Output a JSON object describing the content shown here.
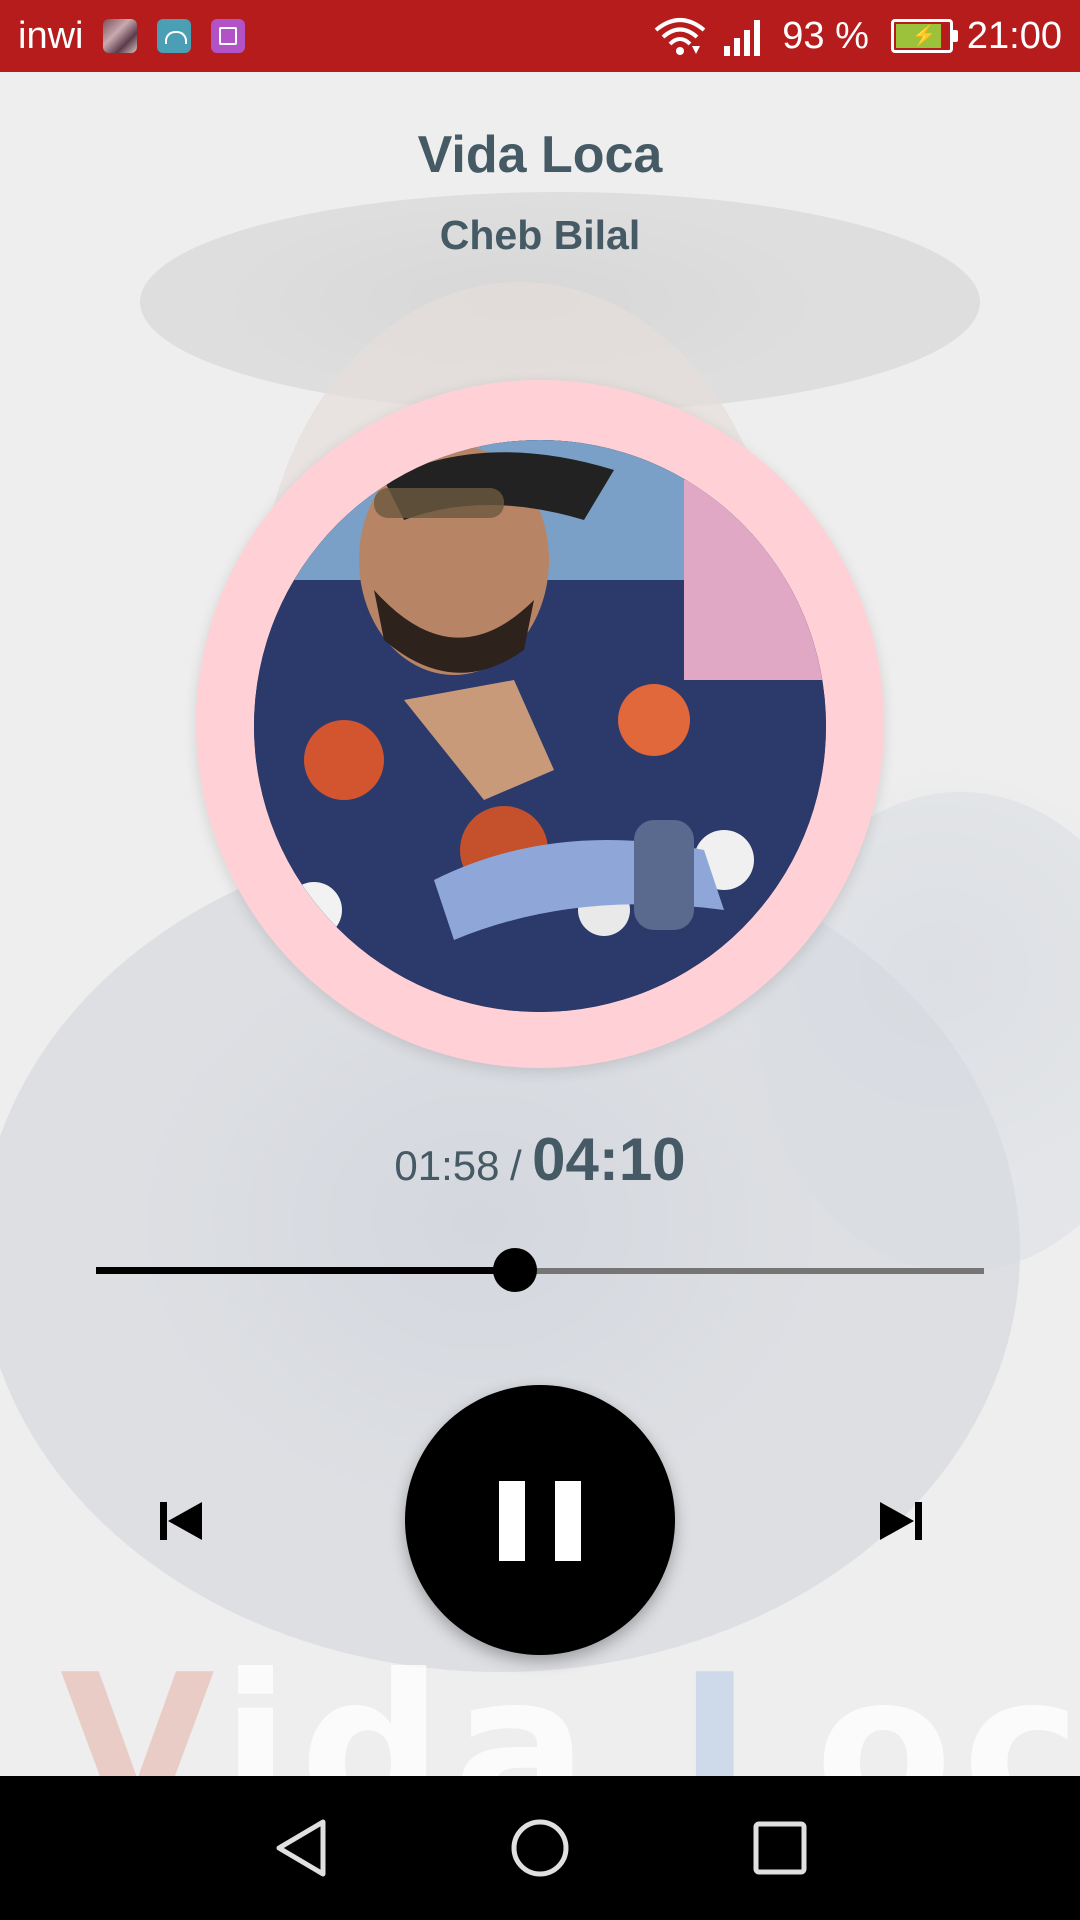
{
  "status_bar": {
    "carrier": "inwi",
    "battery_percent": "93 %",
    "battery_level": 0.93,
    "time": "21:00",
    "notification_icons": [
      "photo-icon",
      "android-icon",
      "gallery-icon"
    ],
    "indicator_icons": [
      "wifi-icon",
      "signal-icon",
      "battery-charging-icon"
    ],
    "background_color": "#b71c1c"
  },
  "player": {
    "title": "Vida Loca",
    "artist": "Cheb Bilal",
    "current_time": "01:58",
    "separator": "/",
    "total_time": "04:10",
    "progress": 0.472,
    "artwork_ring_color": "#ffd1d6",
    "text_color": "#455a64"
  },
  "background_text": "Vida Loca",
  "controls": {
    "previous_icon": "skip-previous-icon",
    "play_pause_icon": "pause-icon",
    "next_icon": "skip-next-icon"
  },
  "nav_bar": {
    "icons": [
      "back-icon",
      "home-icon",
      "recents-icon"
    ]
  }
}
